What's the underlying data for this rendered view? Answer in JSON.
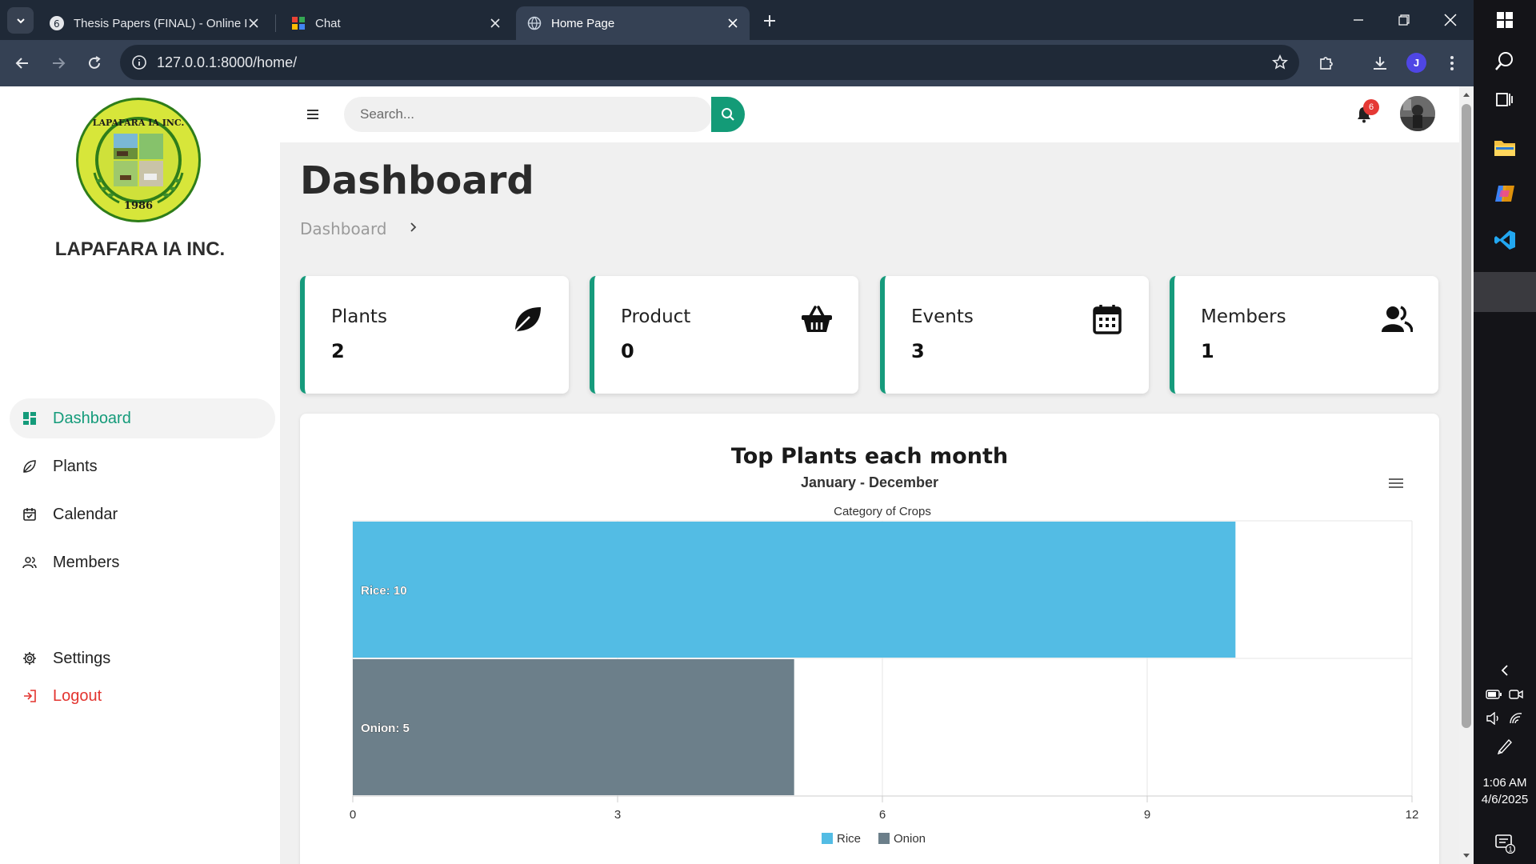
{
  "browser": {
    "tabs": [
      {
        "title": "Thesis Papers (FINAL) - Online L"
      },
      {
        "title": "Chat"
      },
      {
        "title": "Home Page"
      }
    ],
    "url": "127.0.0.1:8000/home/",
    "profile_initial": "J"
  },
  "sidebar": {
    "brand": "LAPAFARA IA INC.",
    "logo": {
      "ring_text": "LAPAFARA IA INC.",
      "year": "1986"
    },
    "items": [
      {
        "label": "Dashboard",
        "icon": "grid-icon",
        "active": true
      },
      {
        "label": "Plants",
        "icon": "leaf-icon"
      },
      {
        "label": "Calendar",
        "icon": "calendar-icon"
      },
      {
        "label": "Members",
        "icon": "users-icon"
      },
      {
        "label": "Settings",
        "icon": "gear-icon"
      },
      {
        "label": "Logout",
        "icon": "logout-icon"
      }
    ]
  },
  "header": {
    "search_placeholder": "Search...",
    "notification_count": "6"
  },
  "main": {
    "title": "Dashboard",
    "breadcrumb": "Dashboard",
    "cards": [
      {
        "label": "Plants",
        "value": "2",
        "icon": "leaf-icon"
      },
      {
        "label": "Product",
        "value": "0",
        "icon": "basket-icon"
      },
      {
        "label": "Events",
        "value": "3",
        "icon": "calendar-icon"
      },
      {
        "label": "Members",
        "value": "1",
        "icon": "users-icon"
      }
    ]
  },
  "chart_data": {
    "type": "bar",
    "orientation": "horizontal",
    "title": "Top Plants each month",
    "subtitle": "January - December",
    "xlabel": "Category of Crops",
    "categories": [
      "Rice",
      "Onion"
    ],
    "values": [
      10,
      5
    ],
    "data_labels": [
      "Rice: 10",
      "Onion: 5"
    ],
    "colors": [
      "#53bce4",
      "#6c7f8a"
    ],
    "xlim": [
      0,
      12
    ],
    "ticks": [
      0,
      3,
      6,
      9,
      12
    ],
    "legend": [
      "Rice",
      "Onion"
    ],
    "legend_position": "bottom",
    "grid": true
  },
  "taskbar": {
    "time": "1:06 AM",
    "date": "4/6/2025",
    "notifications": "1"
  },
  "colors": {
    "accent": "#139b77",
    "logout": "#e3342f",
    "chrome_dark": "#1f2937"
  }
}
